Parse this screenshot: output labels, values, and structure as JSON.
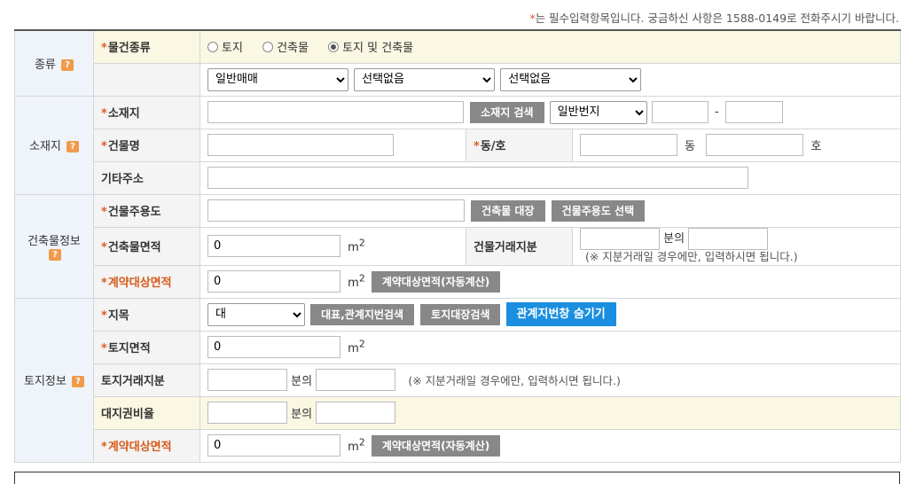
{
  "notice": {
    "star": "*",
    "text": "는 필수입력항목입니다. 궁금하신 사항은 1588-0149로 전화주시기 바랍니다."
  },
  "required_mark": "*",
  "help_icon": "?",
  "sections": {
    "type": "종류",
    "location": "소재지",
    "building": "건축물정보",
    "land": "토지정보"
  },
  "type": {
    "label": "물건종류",
    "radios": [
      {
        "label": "토지",
        "checked": false
      },
      {
        "label": "건축물",
        "checked": false
      },
      {
        "label": "토지 및 건축물",
        "checked": true
      }
    ],
    "selects": [
      "일반매매",
      "선택없음",
      "선택없음"
    ]
  },
  "location": {
    "address_label": "소재지",
    "address_value": "",
    "search_button": "소재지 검색",
    "lot_type": "일반번지",
    "dash": "-",
    "building_name_label": "건물명",
    "dong_ho_label": "동/호",
    "dong_unit": "동",
    "ho_unit": "호",
    "other_address_label": "기타주소"
  },
  "building": {
    "usage_label": "건물주용도",
    "register_button": "건축물 대장",
    "usage_select_button": "건물주용도 선택",
    "area_label": "건축물면적",
    "area_value": "0",
    "unit": "m",
    "unit_sup": "2",
    "share_label": "건물거래지분",
    "share_of": "분의",
    "share_note": "(※ 지분거래일 경우에만, 입력하시면 됩니다.)",
    "contract_area_label": "계약대상면적",
    "contract_area_value": "0",
    "auto_calc_button": "계약대상면적(자동계산)"
  },
  "land": {
    "category_label": "지목",
    "category_value": "대",
    "related_lot_search_button": "대표,관계지번검색",
    "land_register_button": "토지대장검색",
    "hide_related_button": "관계지번창 숨기기",
    "area_label": "토지면적",
    "area_value": "0",
    "share_label": "토지거래지분",
    "share_of": "분의",
    "share_note": "(※ 지분거래일 경우에만, 입력하시면 됩니다.)",
    "site_ratio_label": "대지권비율",
    "site_ratio_of": "분의",
    "contract_area_label": "계약대상면적",
    "contract_area_value": "0",
    "auto_calc_button": "계약대상면적(자동계산)"
  },
  "colors": {
    "required": "#e05a2a",
    "blue_button": "#1a8fe0",
    "gray_button": "#888888",
    "section_bg": "#eef4fa",
    "highlight_bg": "#faf7e3"
  }
}
